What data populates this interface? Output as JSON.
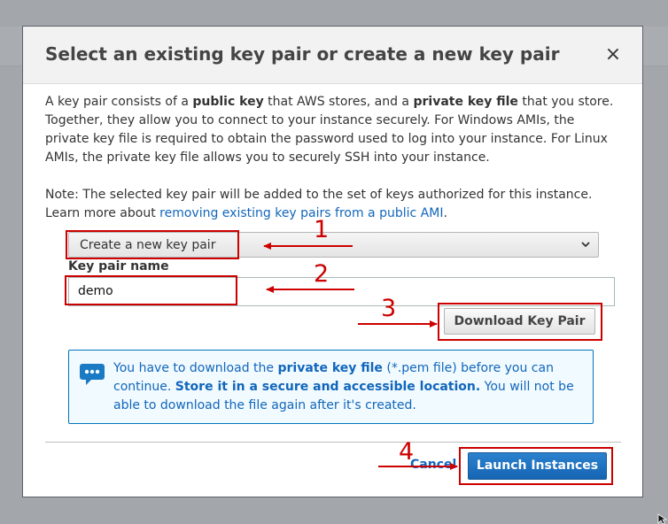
{
  "modal": {
    "title": "Select an existing key pair or create a new key pair",
    "close_symbol": "×",
    "intro": {
      "t1": "A key pair consists of a ",
      "b1": "public key",
      "t2": " that AWS stores, and a ",
      "b2": "private key file",
      "t3": " that you store. Together, they allow you to connect to your instance securely. For Windows AMIs, the private key file is required to obtain the password used to log into your instance. For Linux AMIs, the private key file allows you to securely SSH into your instance."
    },
    "note": {
      "text": "Note: The selected key pair will be added to the set of keys authorized for this instance. Learn more about ",
      "link": "removing existing key pairs from a public AMI",
      "end": "."
    },
    "key_pair_select": {
      "value": "Create a new key pair"
    },
    "key_pair_name": {
      "label": "Key pair name",
      "value": "demo"
    },
    "download_button": "Download Key Pair",
    "info": {
      "t1": "You have to download the ",
      "b1": "private key file",
      "t2": " (*.pem file) before you can continue. ",
      "b2": "Store it in a secure and accessible location.",
      "t3": " You will not be able to download the file again after it's created."
    },
    "footer": {
      "cancel": "Cancel",
      "launch": "Launch Instances"
    }
  },
  "annotations": {
    "color": "#cc0000",
    "steps": [
      "1",
      "2",
      "3",
      "4"
    ]
  },
  "icons": {
    "info": "speech-bubble-icon",
    "chevron": "chevron-down-icon",
    "close": "close-icon"
  },
  "colors": {
    "link": "#1166bb",
    "primary_button": "#1a6fc0",
    "info_background": "#f1faff",
    "info_border": "#0073bb"
  }
}
